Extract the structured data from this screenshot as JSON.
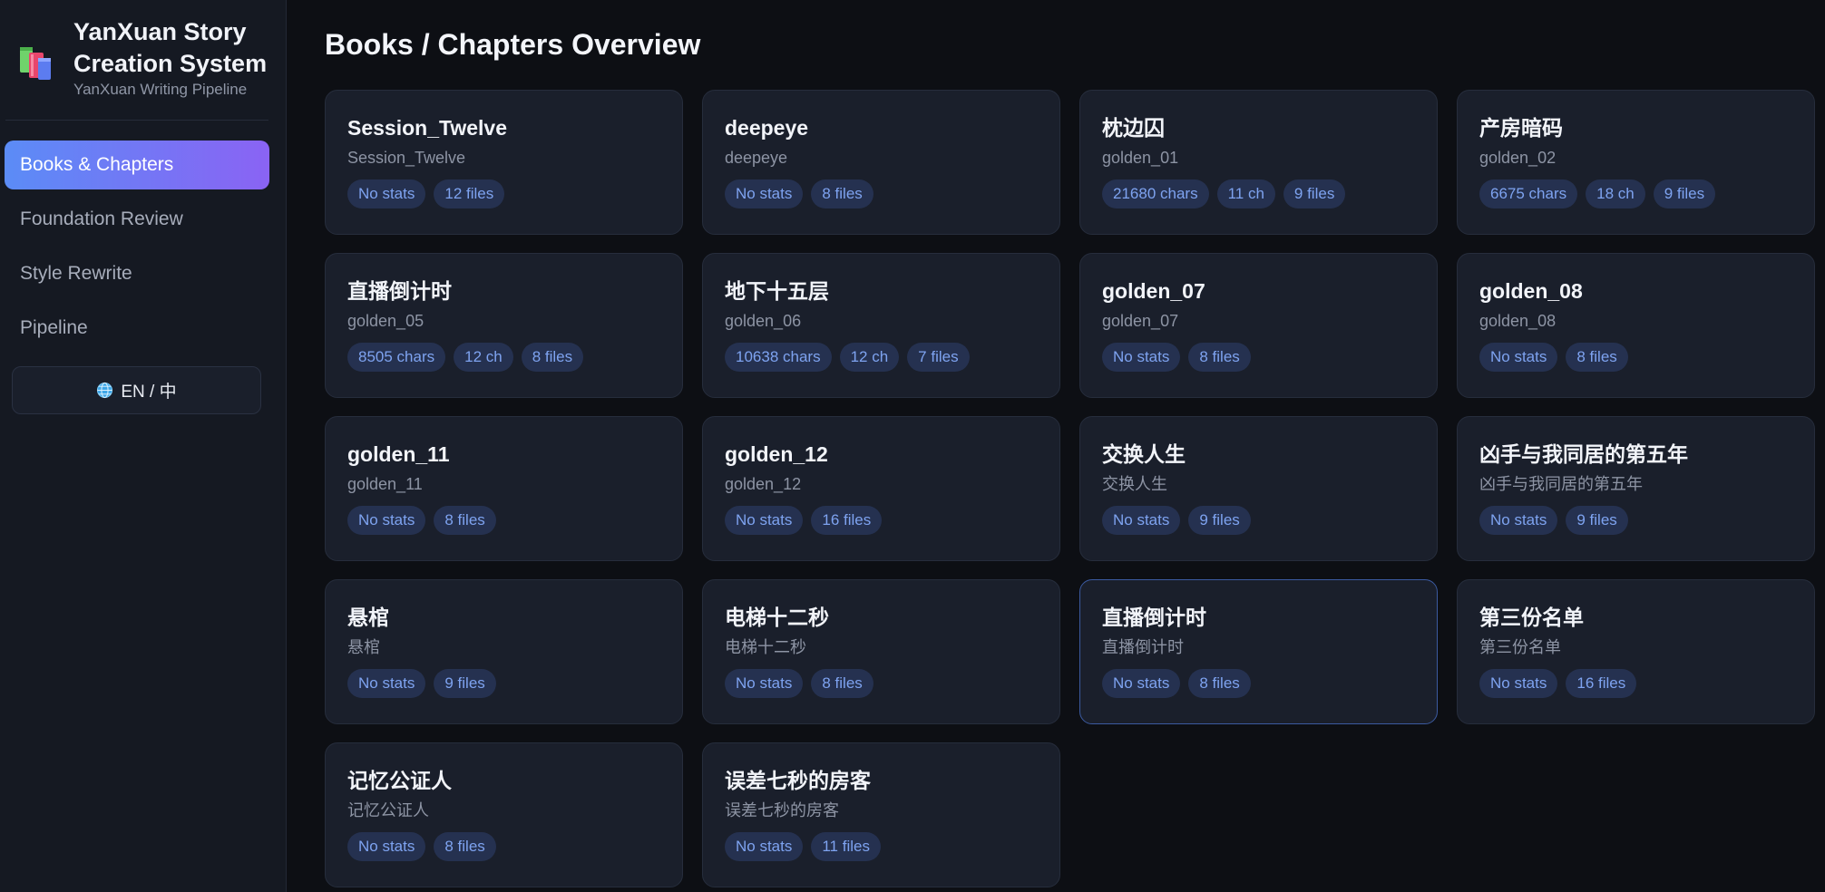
{
  "sidebar": {
    "app_title": "YanXuan Story Creation System",
    "app_subtitle": "YanXuan Writing Pipeline",
    "logo_icon": "books-icon",
    "nav": [
      {
        "label": "Books & Chapters",
        "active": true
      },
      {
        "label": "Foundation Review",
        "active": false
      },
      {
        "label": "Style Rewrite",
        "active": false
      },
      {
        "label": "Pipeline",
        "active": false
      }
    ],
    "language_toggle": {
      "icon": "globe-icon",
      "label": "EN / 中"
    }
  },
  "main": {
    "title": "Books / Chapters Overview",
    "books": [
      {
        "title": "Session_Twelve",
        "id": "Session_Twelve",
        "tags": [
          "No stats",
          "12 files"
        ]
      },
      {
        "title": "deepeye",
        "id": "deepeye",
        "tags": [
          "No stats",
          "8 files"
        ]
      },
      {
        "title": "枕边囚",
        "id": "golden_01",
        "tags": [
          "21680 chars",
          "11 ch",
          "9 files"
        ]
      },
      {
        "title": "产房暗码",
        "id": "golden_02",
        "tags": [
          "6675 chars",
          "18 ch",
          "9 files"
        ]
      },
      {
        "title": "直播倒计时",
        "id": "golden_05",
        "tags": [
          "8505 chars",
          "12 ch",
          "8 files"
        ]
      },
      {
        "title": "地下十五层",
        "id": "golden_06",
        "tags": [
          "10638 chars",
          "12 ch",
          "7 files"
        ]
      },
      {
        "title": "golden_07",
        "id": "golden_07",
        "tags": [
          "No stats",
          "8 files"
        ]
      },
      {
        "title": "golden_08",
        "id": "golden_08",
        "tags": [
          "No stats",
          "8 files"
        ]
      },
      {
        "title": "golden_11",
        "id": "golden_11",
        "tags": [
          "No stats",
          "8 files"
        ]
      },
      {
        "title": "golden_12",
        "id": "golden_12",
        "tags": [
          "No stats",
          "16 files"
        ]
      },
      {
        "title": "交换人生",
        "id": "交换人生",
        "tags": [
          "No stats",
          "9 files"
        ]
      },
      {
        "title": "凶手与我同居的第五年",
        "id": "凶手与我同居的第五年",
        "tags": [
          "No stats",
          "9 files"
        ]
      },
      {
        "title": "悬棺",
        "id": "悬棺",
        "tags": [
          "No stats",
          "9 files"
        ]
      },
      {
        "title": "电梯十二秒",
        "id": "电梯十二秒",
        "tags": [
          "No stats",
          "8 files"
        ]
      },
      {
        "title": "直播倒计时",
        "id": "直播倒计时",
        "tags": [
          "No stats",
          "8 files"
        ],
        "selected": true
      },
      {
        "title": "第三份名单",
        "id": "第三份名单",
        "tags": [
          "No stats",
          "16 files"
        ]
      },
      {
        "title": "记忆公证人",
        "id": "记忆公证人",
        "tags": [
          "No stats",
          "8 files"
        ]
      },
      {
        "title": "误差七秒的房客",
        "id": "误差七秒的房客",
        "tags": [
          "No stats",
          "11 files"
        ]
      }
    ]
  },
  "colors": {
    "background": "#0d0f14",
    "sidebar": "#151922",
    "card": "#1a1f2b",
    "accent_start": "#5b8cf6",
    "accent_end": "#8a63f4",
    "tag_bg": "#253150",
    "tag_text": "#7ea3f0"
  }
}
